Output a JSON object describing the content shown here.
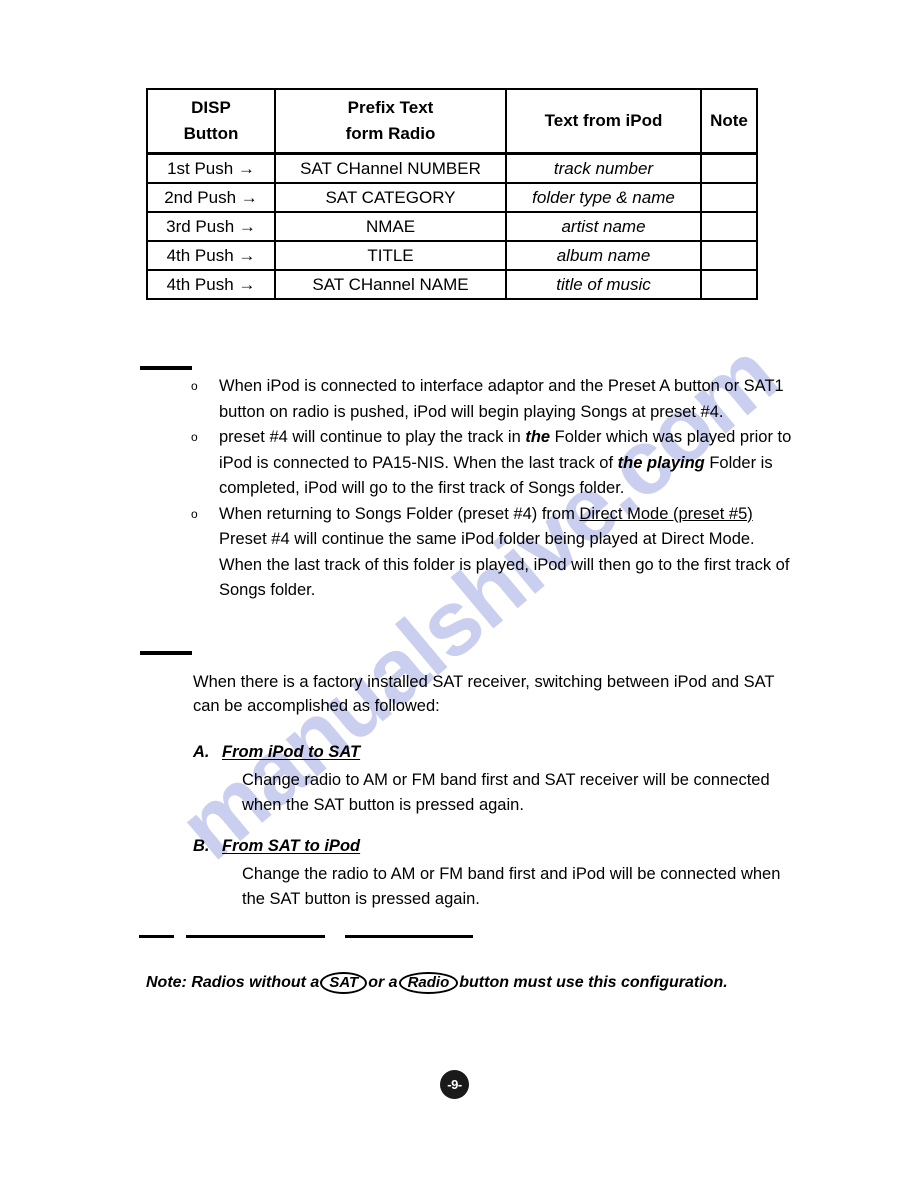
{
  "page": {
    "number_label": "-9-",
    "watermark_text": "manualshive.com"
  },
  "table": {
    "headers": [
      {
        "line1": "DISP",
        "line2": "Button"
      },
      {
        "line1": "Prefix Text",
        "line2": "form Radio"
      },
      {
        "line1": "Text from iPod",
        "line2": ""
      },
      {
        "line1": "Note",
        "line2": ""
      }
    ],
    "rows": [
      {
        "push": "1st Push →",
        "prefix": "SAT CHannel NUMBER",
        "ipod": "track number",
        "note": ""
      },
      {
        "push": "2nd Push →",
        "prefix": "SAT CATEGORY",
        "ipod": "folder type & name",
        "note": ""
      },
      {
        "push": "3rd Push →",
        "prefix": "NMAE",
        "ipod": "artist name",
        "note": ""
      },
      {
        "push": "4th Push →",
        "prefix": "TITLE",
        "ipod": "album name",
        "note": ""
      },
      {
        "push": "4th Push →",
        "prefix": "SAT CHannel NAME",
        "ipod": "title of music",
        "note": ""
      }
    ]
  },
  "bullets": {
    "marker": "o",
    "items": [
      {
        "segments": [
          {
            "text": "When iPod is connected to interface adaptor and the Preset A button or SAT1 button on radio is pushed, iPod will begin playing  Songs at preset #4.",
            "style": "normal"
          }
        ]
      },
      {
        "segments": [
          {
            "text": "preset #4 will continue to play the track in ",
            "style": "normal"
          },
          {
            "text": "the",
            "style": "bold-italic"
          },
          {
            "text": " Folder which was played prior to iPod is connected to PA15-NIS. When the last track of ",
            "style": "normal"
          },
          {
            "text": "the playing",
            "style": "bold-italic"
          },
          {
            "text": " Folder is completed, iPod will go to the first track of Songs folder.",
            "style": "normal"
          }
        ]
      },
      {
        "segments": [
          {
            "text": "When returning to Songs Folder (preset #4) from ",
            "style": "normal"
          },
          {
            "text": "Direct Mode (preset #5)",
            "style": "underline"
          },
          {
            "text": " Preset #4 will continue the same iPod folder being played at Direct Mode. When the last track of this folder is played, iPod will then go to the first track of Songs folder.",
            "style": "normal"
          }
        ]
      }
    ]
  },
  "sat_section": {
    "intro": "When there is a factory installed SAT receiver, switching between iPod and SAT can be accomplished as followed:",
    "items": [
      {
        "letter": "A.",
        "title": "From iPod to SAT ",
        "body": "Change radio to AM or FM band first and SAT receiver will be connected when the SAT button is pressed again."
      },
      {
        "letter": "B.",
        "title": "From SAT to iPod",
        "body": "Change the radio to AM or FM band first and iPod will be connected when the SAT button is pressed again."
      }
    ]
  },
  "note": {
    "prefix": "Note: Radios without a ",
    "oval_1": "SAT",
    "middle": "or a ",
    "oval_2": "Radio",
    "suffix": " button must use this configuration."
  }
}
